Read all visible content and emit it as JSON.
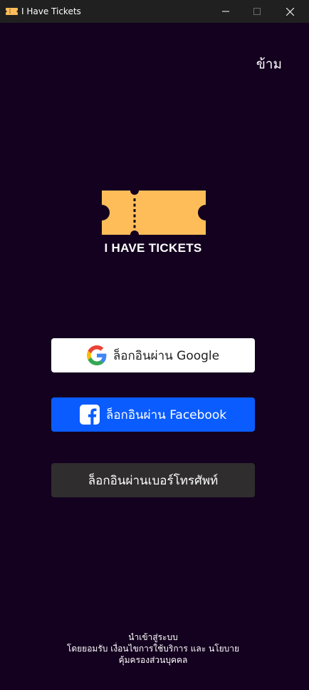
{
  "window": {
    "title": "I Have Tickets",
    "app_icon": "ticket-icon",
    "controls": [
      "minimize-icon",
      "maximize-icon",
      "close-icon"
    ]
  },
  "header": {
    "skip_label": "ข้าม"
  },
  "brand": {
    "logo": "ticket-icon",
    "name": "I HAVE TICKETS",
    "logo_color": "#ffbd59"
  },
  "login": {
    "google_label": "ล็อกอินผ่าน Google",
    "facebook_label": "ล็อกอินผ่าน Facebook",
    "phone_label": "ล็อกอินผ่านเบอร์โทรศัพท์",
    "google_icon": "google-icon",
    "facebook_icon": "facebook-icon"
  },
  "footer": {
    "line1": "นำเข้าสู่ระบบ",
    "line2_prefix": "โดยยอมรับ",
    "terms_link": "เงื่อนไขการใช้บริการ",
    "and": "และ",
    "policy_link_part1": "นโยบาย",
    "policy_link_part2": "คุ้มครองส่วนบุคคล"
  },
  "colors": {
    "background": "#14001f",
    "titlebar": "#202020",
    "google_button": "#ffffff",
    "facebook_button": "#0a5cff",
    "phone_button": "#2f2d2e"
  }
}
